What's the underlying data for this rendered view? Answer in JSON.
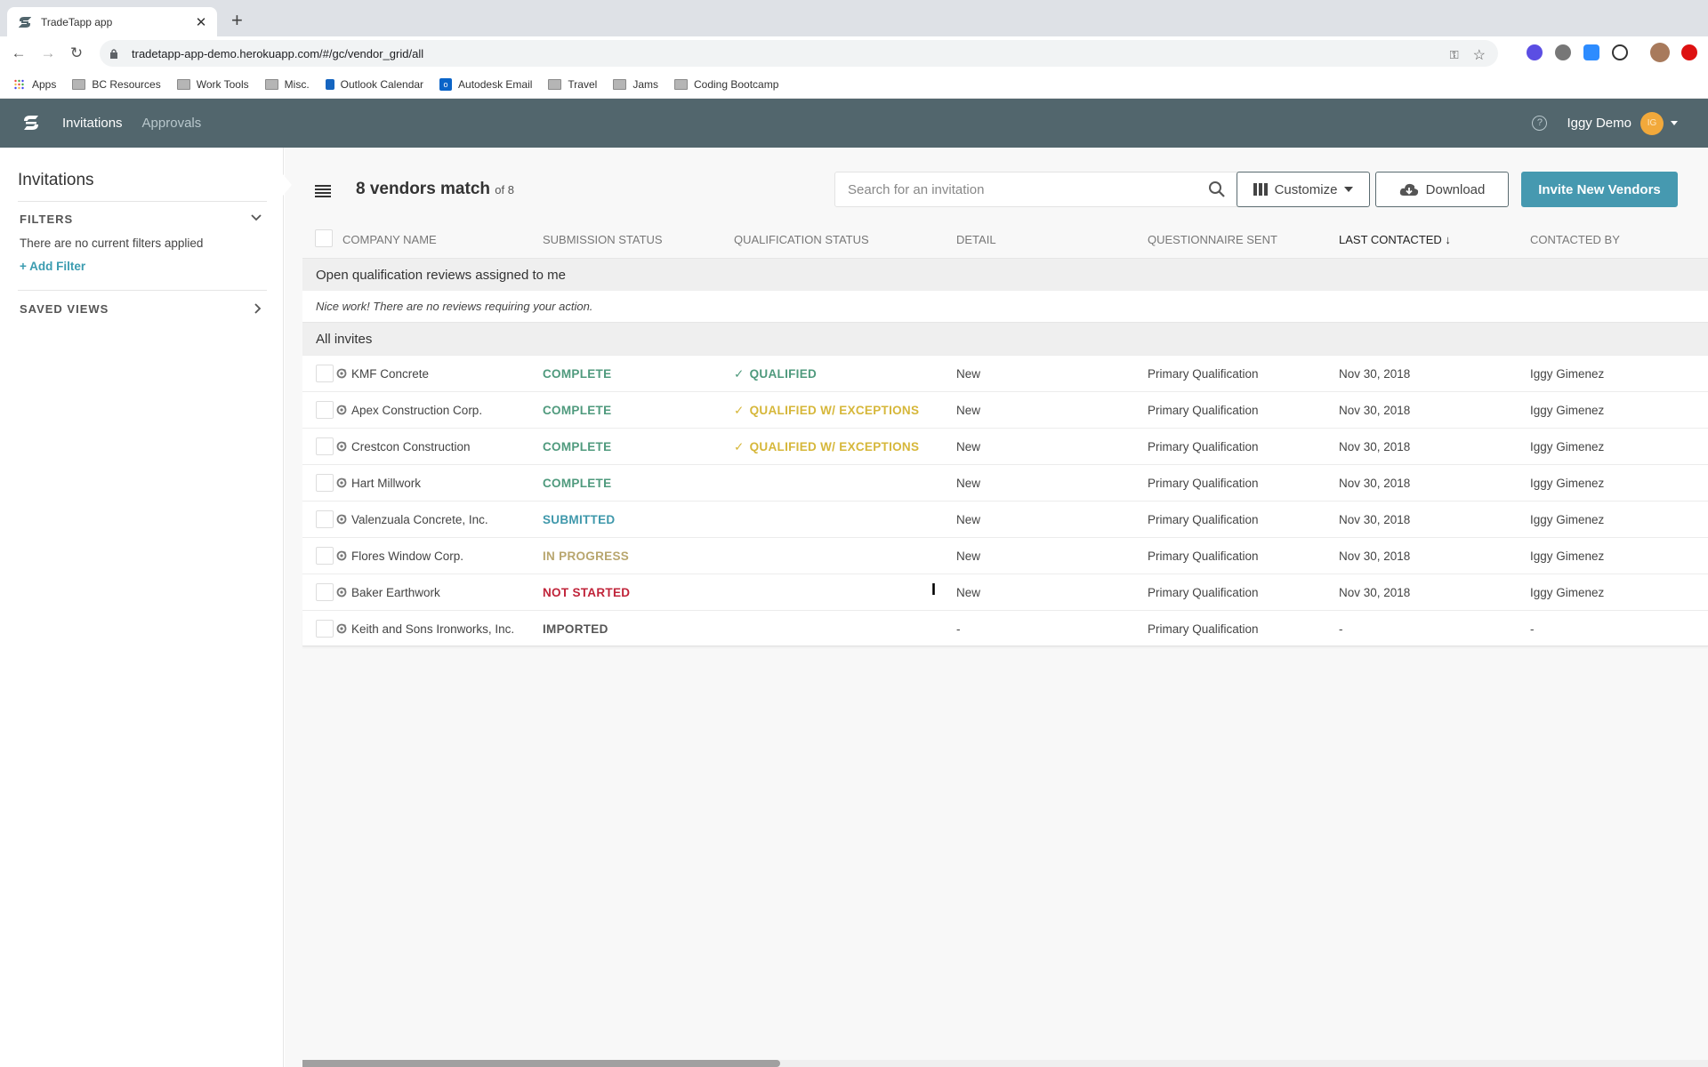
{
  "browser": {
    "tab_title": "TradeTapp app",
    "url": "tradetapp-app-demo.herokuapp.com/#/gc/vendor_grid/all",
    "bookmarks": [
      {
        "label": "Apps",
        "icon": "apps-grid-icon"
      },
      {
        "label": "BC Resources",
        "icon": "building-folder-icon"
      },
      {
        "label": "Work Tools",
        "icon": "folder-icon"
      },
      {
        "label": "Misc.",
        "icon": "folder-icon"
      },
      {
        "label": "Outlook Calendar",
        "icon": "outlook-calendar-icon"
      },
      {
        "label": "Autodesk Email",
        "icon": "outlook-mail-icon"
      },
      {
        "label": "Travel",
        "icon": "folder-icon"
      },
      {
        "label": "Jams",
        "icon": "folder-icon"
      },
      {
        "label": "Coding Bootcamp",
        "icon": "folder-icon"
      }
    ]
  },
  "app": {
    "nav": [
      {
        "label": "Invitations",
        "active": true
      },
      {
        "label": "Approvals",
        "active": false
      }
    ],
    "user": {
      "name": "Iggy Demo",
      "initials": "IG"
    },
    "colors": {
      "header_bg": "#52666d",
      "accent": "#4699b0",
      "link": "#3b9cb0",
      "avatar": "#f2a93b",
      "status_complete": "#4f9a7d",
      "status_submitted": "#3f98ab",
      "status_in_progress": "#b8a66e",
      "status_not_started": "#c0243a",
      "status_imported": "#555555",
      "qual_qualified": "#4f9a7d",
      "qual_exceptions": "#d6b73a"
    }
  },
  "sidebar": {
    "title": "Invitations",
    "filters_label": "FILTERS",
    "filters_empty": "There are no current filters applied",
    "add_filter": "+ Add Filter",
    "saved_views_label": "SAVED VIEWS"
  },
  "main": {
    "count_text": "8 vendors match",
    "count_of": "of 8",
    "search_placeholder": "Search for an invitation",
    "customize_label": "Customize",
    "download_label": "Download",
    "invite_label": "Invite New Vendors",
    "columns": [
      {
        "label": "COMPANY NAME",
        "sorted": false
      },
      {
        "label": "SUBMISSION STATUS",
        "sorted": false
      },
      {
        "label": "QUALIFICATION STATUS",
        "sorted": false
      },
      {
        "label": "DETAIL",
        "sorted": false
      },
      {
        "label": "QUESTIONNAIRE SENT",
        "sorted": false
      },
      {
        "label": "LAST CONTACTED ↓",
        "sorted": true
      },
      {
        "label": "CONTACTED BY",
        "sorted": false
      }
    ],
    "review_group": {
      "title": "Open qualification reviews assigned to me",
      "empty_note": "Nice work! There are no reviews requiring your action."
    },
    "all_group_title": "All invites",
    "rows": [
      {
        "company": "KMF Concrete",
        "submission": "COMPLETE",
        "submission_kind": "complete",
        "qualification": "QUALIFIED",
        "qual_kind": "qualified",
        "detail": "New",
        "questionnaire": "Primary Qualification",
        "last_contacted": "Nov 30, 2018",
        "contacted_by": "Iggy Gimenez"
      },
      {
        "company": "Apex Construction Corp.",
        "submission": "COMPLETE",
        "submission_kind": "complete",
        "qualification": "QUALIFIED W/ EXCEPTIONS",
        "qual_kind": "exceptions",
        "detail": "New",
        "questionnaire": "Primary Qualification",
        "last_contacted": "Nov 30, 2018",
        "contacted_by": "Iggy Gimenez"
      },
      {
        "company": "Crestcon Construction",
        "submission": "COMPLETE",
        "submission_kind": "complete",
        "qualification": "QUALIFIED W/ EXCEPTIONS",
        "qual_kind": "exceptions",
        "detail": "New",
        "questionnaire": "Primary Qualification",
        "last_contacted": "Nov 30, 2018",
        "contacted_by": "Iggy Gimenez"
      },
      {
        "company": "Hart Millwork",
        "submission": "COMPLETE",
        "submission_kind": "complete",
        "qualification": "",
        "qual_kind": "",
        "detail": "New",
        "questionnaire": "Primary Qualification",
        "last_contacted": "Nov 30, 2018",
        "contacted_by": "Iggy Gimenez"
      },
      {
        "company": "Valenzuala Concrete, Inc.",
        "submission": "SUBMITTED",
        "submission_kind": "submitted",
        "qualification": "",
        "qual_kind": "",
        "detail": "New",
        "questionnaire": "Primary Qualification",
        "last_contacted": "Nov 30, 2018",
        "contacted_by": "Iggy Gimenez"
      },
      {
        "company": "Flores Window Corp.",
        "submission": "IN PROGRESS",
        "submission_kind": "in_progress",
        "qualification": "",
        "qual_kind": "",
        "detail": "New",
        "questionnaire": "Primary Qualification",
        "last_contacted": "Nov 30, 2018",
        "contacted_by": "Iggy Gimenez"
      },
      {
        "company": "Baker Earthwork",
        "submission": "NOT STARTED",
        "submission_kind": "not_started",
        "qualification": "",
        "qual_kind": "",
        "detail": "New",
        "questionnaire": "Primary Qualification",
        "last_contacted": "Nov 30, 2018",
        "contacted_by": "Iggy Gimenez"
      },
      {
        "company": "Keith and Sons Ironworks, Inc.",
        "submission": "IMPORTED",
        "submission_kind": "imported",
        "qualification": "",
        "qual_kind": "",
        "detail": "-",
        "questionnaire": "Primary Qualification",
        "last_contacted": "-",
        "contacted_by": "-"
      }
    ],
    "horizontal_scroll_fraction": 0.34
  }
}
